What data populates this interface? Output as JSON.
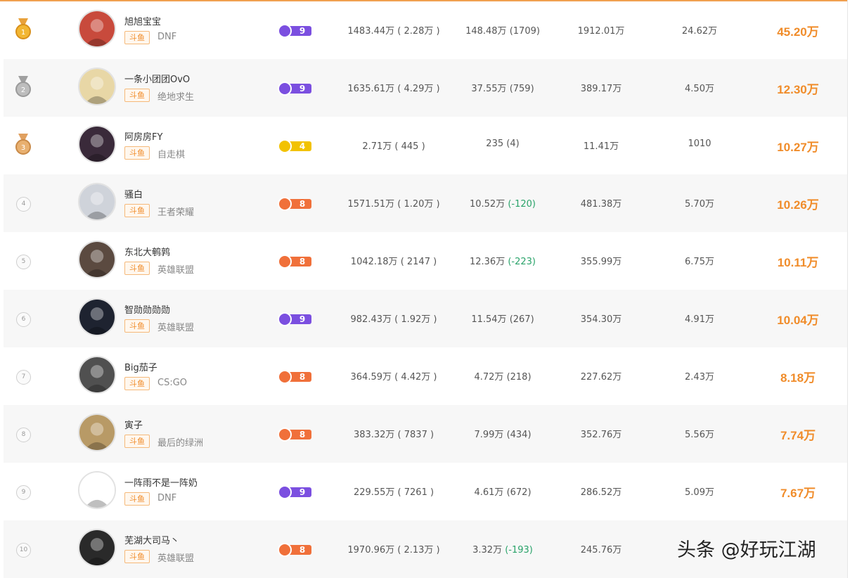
{
  "rows": [
    {
      "rank": "1",
      "medal": "gold",
      "name": "旭旭宝宝",
      "platform": "斗鱼",
      "category": "DNF",
      "level": "9",
      "level_color": "#7b4fe0",
      "c1": "1483.44万 ( 2.28万 )",
      "c2_main": "148.48万",
      "c2_delta": "(1709)",
      "c2_neg": false,
      "c3": "1912.01万",
      "c4": "24.62万",
      "score": "45.20万",
      "avatar": "#c84a3c"
    },
    {
      "rank": "2",
      "medal": "silver",
      "name": "一条小团团OvO",
      "platform": "斗鱼",
      "category": "绝地求生",
      "level": "9",
      "level_color": "#7b4fe0",
      "c1": "1635.61万 ( 4.29万 )",
      "c2_main": "37.55万",
      "c2_delta": "(759)",
      "c2_neg": false,
      "c3": "389.17万",
      "c4": "4.50万",
      "score": "12.30万",
      "avatar": "#e8d7a6"
    },
    {
      "rank": "3",
      "medal": "bronze",
      "name": "阿房房FY",
      "platform": "斗鱼",
      "category": "自走棋",
      "level": "4",
      "level_color": "#f2c200",
      "c1": "2.71万 ( 445 )",
      "c2_main": "235",
      "c2_delta": "(4)",
      "c2_neg": false,
      "c3": "11.41万",
      "c4": "1010",
      "score": "10.27万",
      "avatar": "#3a2a3a"
    },
    {
      "rank": "4",
      "medal": "",
      "name": "骚白",
      "platform": "斗鱼",
      "category": "王者荣耀",
      "level": "8",
      "level_color": "#f0703a",
      "c1": "1571.51万 ( 1.20万 )",
      "c2_main": "10.52万",
      "c2_delta": "(-120)",
      "c2_neg": true,
      "c3": "481.38万",
      "c4": "5.70万",
      "score": "10.26万",
      "avatar": "#cfd3da"
    },
    {
      "rank": "5",
      "medal": "",
      "name": "东北大鹌鹑",
      "platform": "斗鱼",
      "category": "英雄联盟",
      "level": "8",
      "level_color": "#f0703a",
      "c1": "1042.18万 ( 2147 )",
      "c2_main": "12.36万",
      "c2_delta": "(-223)",
      "c2_neg": true,
      "c3": "355.99万",
      "c4": "6.75万",
      "score": "10.11万",
      "avatar": "#5b4a40"
    },
    {
      "rank": "6",
      "medal": "",
      "name": "智勋勋勋勋",
      "platform": "斗鱼",
      "category": "英雄联盟",
      "level": "9",
      "level_color": "#7b4fe0",
      "c1": "982.43万 ( 1.92万 )",
      "c2_main": "11.54万",
      "c2_delta": "(267)",
      "c2_neg": false,
      "c3": "354.30万",
      "c4": "4.91万",
      "score": "10.04万",
      "avatar": "#1e2330"
    },
    {
      "rank": "7",
      "medal": "",
      "name": "Big茄子",
      "platform": "斗鱼",
      "category": "CS:GO",
      "level": "8",
      "level_color": "#f0703a",
      "c1": "364.59万 ( 4.42万 )",
      "c2_main": "4.72万",
      "c2_delta": "(218)",
      "c2_neg": false,
      "c3": "227.62万",
      "c4": "2.43万",
      "score": "8.18万",
      "avatar": "#505050"
    },
    {
      "rank": "8",
      "medal": "",
      "name": "寅子",
      "platform": "斗鱼",
      "category": "最后的绿洲",
      "level": "8",
      "level_color": "#f0703a",
      "c1": "383.32万 ( 7837 )",
      "c2_main": "7.99万",
      "c2_delta": "(434)",
      "c2_neg": false,
      "c3": "352.76万",
      "c4": "5.56万",
      "score": "7.74万",
      "avatar": "#b89a66"
    },
    {
      "rank": "9",
      "medal": "",
      "name": "一阵雨不是一阵奶",
      "platform": "斗鱼",
      "category": "DNF",
      "level": "9",
      "level_color": "#7b4fe0",
      "c1": "229.55万 ( 7261 )",
      "c2_main": "4.61万",
      "c2_delta": "(672)",
      "c2_neg": false,
      "c3": "286.52万",
      "c4": "5.09万",
      "score": "7.67万",
      "avatar": "#ffffff"
    },
    {
      "rank": "10",
      "medal": "",
      "name": "芜湖大司马丶",
      "platform": "斗鱼",
      "category": "英雄联盟",
      "level": "8",
      "level_color": "#f0703a",
      "c1": "1970.96万 ( 2.13万 )",
      "c2_main": "3.32万",
      "c2_delta": "(-193)",
      "c2_neg": true,
      "c3": "245.76万",
      "c4": "",
      "score": "",
      "avatar": "#2a2a2a"
    }
  ],
  "watermark": "头条 @好玩江湖",
  "colors": {
    "accent": "#f08c2a",
    "negative": "#2aa36a",
    "purple_level": "#7b4fe0",
    "orange_level": "#f0703a",
    "yellow_level": "#f2c200"
  }
}
